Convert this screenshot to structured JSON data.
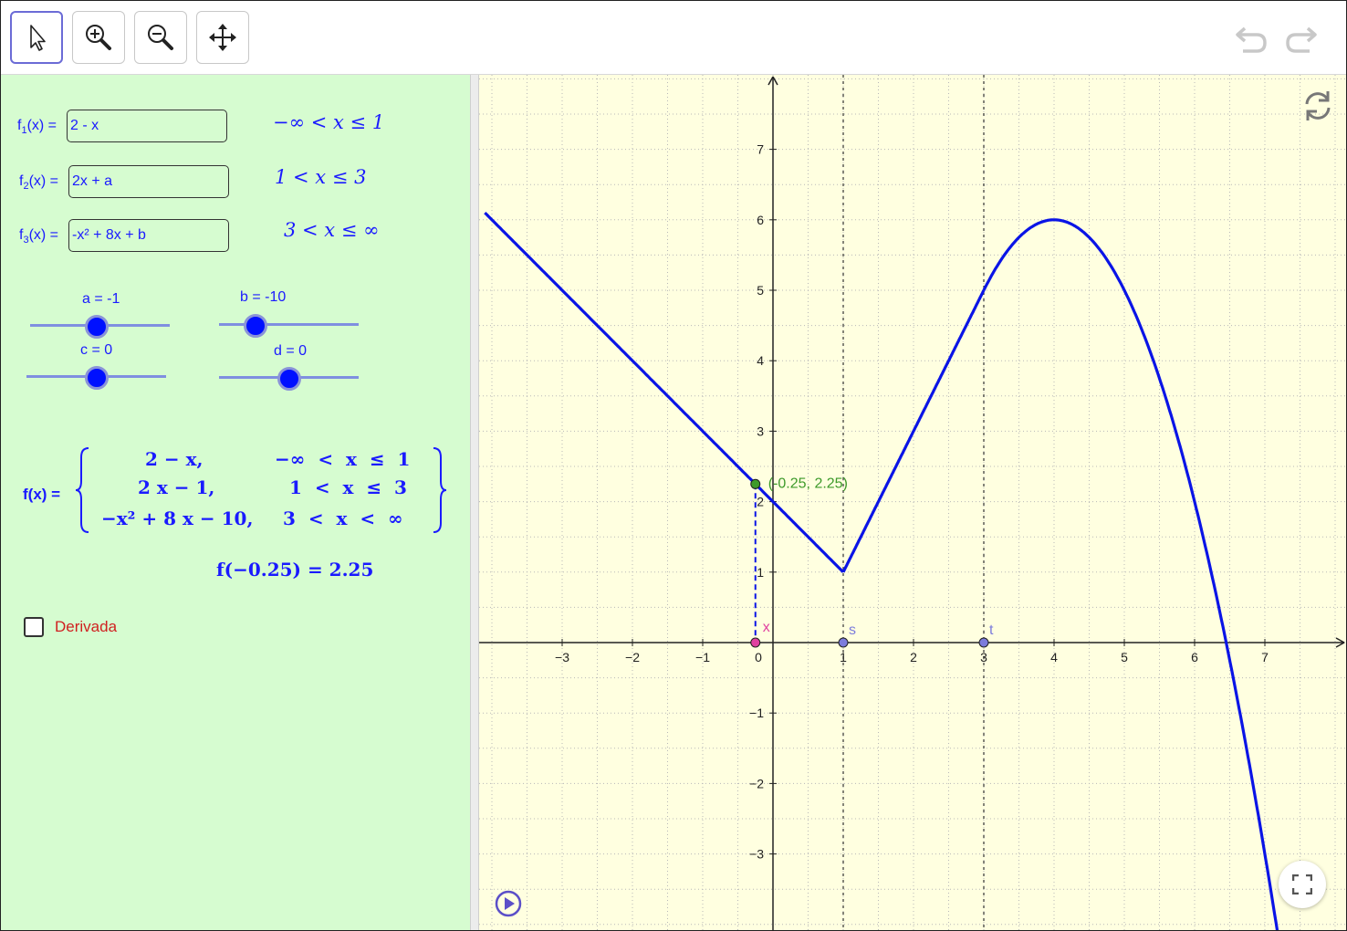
{
  "toolbar": {
    "tools": [
      "Move",
      "Zoom In",
      "Zoom Out",
      "Move Graphics View"
    ],
    "undo_icon": "undo-icon",
    "redo_icon": "redo-icon"
  },
  "algebra": {
    "f1": {
      "label_main": "f",
      "label_sub": "1",
      "label_tail": "(x) =",
      "value": "2 - x",
      "condition": "−∞ < x ≤ 1"
    },
    "f2": {
      "label_main": "f",
      "label_sub": "2",
      "label_tail": "(x) =",
      "value": "2x + a",
      "condition": "1 < x ≤ 3"
    },
    "f3": {
      "label_main": "f",
      "label_sub": "3",
      "label_tail": "(x) =",
      "value": "-x² + 8x + b",
      "condition": "3 < x ≤ ∞"
    },
    "sliders": {
      "a": {
        "label": "a = -1",
        "fraction": 0.48
      },
      "b": {
        "label": "b = -10",
        "fraction": 0.26
      },
      "c": {
        "label": "c = 0",
        "fraction": 0.5
      },
      "d": {
        "label": "d = 0",
        "fraction": 0.5
      }
    },
    "piecewise": {
      "label": "f(x) =",
      "rows": [
        {
          "expr": "2 − x,",
          "cond": "−∞  <  x  ≤  1"
        },
        {
          "expr": "2 x − 1,",
          "cond": "1  <  x  ≤  3"
        },
        {
          "expr": "−x² + 8 x − 10,",
          "cond": "3  <  x  <  ∞"
        }
      ]
    },
    "evaluation": "f(−0.25) = 2.25",
    "derivative_checkbox": {
      "label": "Derivada",
      "checked": false
    }
  },
  "graph": {
    "x_ticks": [
      "−3",
      "−2",
      "−1",
      "0",
      "1",
      "2",
      "3",
      "4",
      "5",
      "6",
      "7"
    ],
    "y_ticks": [
      "7",
      "6",
      "5",
      "4",
      "3",
      "2",
      "1",
      "−1",
      "−2",
      "−3"
    ],
    "point_label": "(-0.25, 2.25)",
    "point_x_label": "x",
    "point_s_label": "s",
    "point_t_label": "t",
    "colors": {
      "curve": "#0a14e6",
      "point": "#3d9a2a",
      "x_point": "#e040a0",
      "st_point": "#7c7cdc",
      "background": "#ffffe0",
      "grid": "#b8b8b8"
    }
  },
  "chart_data": {
    "type": "line",
    "title": "",
    "xlabel": "",
    "ylabel": "",
    "xlim": [
      -4.1,
      8.2
    ],
    "ylim": [
      -4.1,
      8.1
    ],
    "grid": true,
    "series": [
      {
        "definition": "2 - x",
        "domain": [
          -4.1,
          1
        ],
        "x": [
          -4.1,
          1
        ],
        "y": [
          6.1,
          1
        ]
      },
      {
        "definition": "2x - 1",
        "domain": [
          1,
          3
        ],
        "x": [
          1,
          3
        ],
        "y": [
          1,
          5
        ]
      },
      {
        "definition": "-x^2 + 8x - 10",
        "domain": [
          3,
          7.2
        ],
        "x": [
          3,
          4,
          5,
          6,
          6.45,
          7,
          7.2
        ],
        "y": [
          5,
          6,
          5,
          2,
          0,
          -3,
          -4.24
        ]
      }
    ],
    "points": [
      {
        "name": "point",
        "x": -0.25,
        "y": 2.25
      },
      {
        "name": "x",
        "x": -0.25,
        "y": 0
      },
      {
        "name": "s",
        "x": 1,
        "y": 0
      },
      {
        "name": "t",
        "x": 3,
        "y": 0
      }
    ],
    "vertical_dashed_lines": [
      1,
      3
    ]
  }
}
